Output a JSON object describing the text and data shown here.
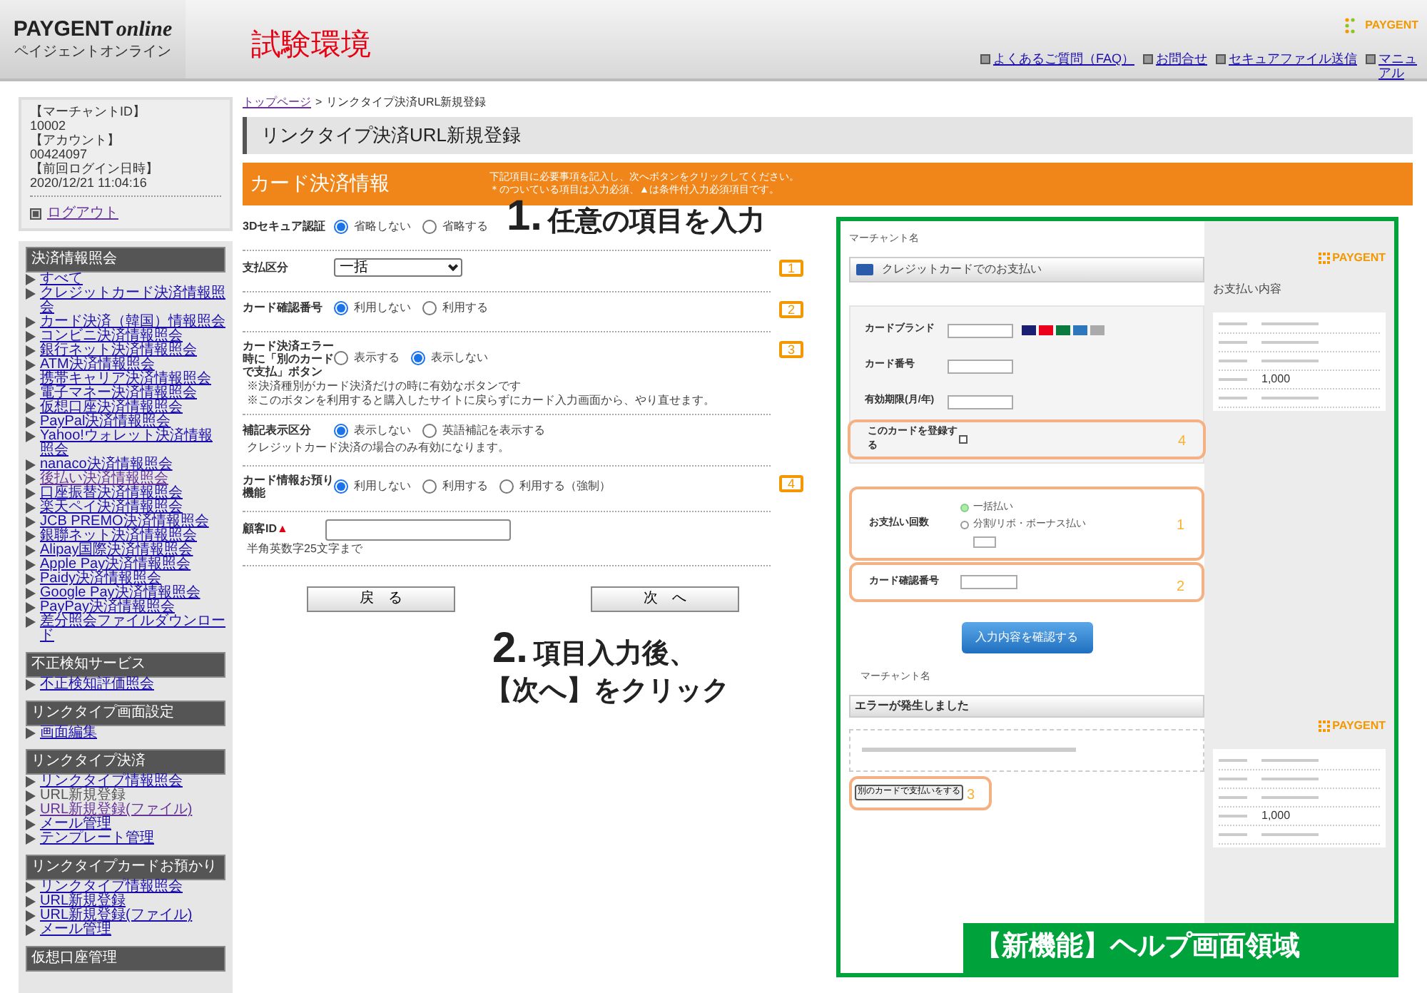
{
  "header": {
    "logo_title": "PAYGENT",
    "logo_suffix": "online",
    "logo_subtitle": "ペイジェントオンライン",
    "environment": "試験環境",
    "brand": "PAYGENT",
    "links": [
      "よくあるご質問（FAQ）",
      "お問合せ",
      "セキュアファイル送信",
      "マニュアル"
    ]
  },
  "account": {
    "lines": [
      "【マーチャントID】",
      "10002",
      "【アカウント】",
      "00424097",
      "【前回ログイン日時】",
      "2020/12/21 11:04:16"
    ],
    "logout": "ログアウト"
  },
  "sidebar": {
    "sections": [
      {
        "title": "決済情報照会",
        "items": [
          {
            "label": "すべて",
            "visited": false,
            "selected": false
          },
          {
            "label": "クレジットカード決済情報照会",
            "visited": false,
            "selected": false
          },
          {
            "label": "カード決済（韓国）情報照会",
            "visited": false,
            "selected": false
          },
          {
            "label": "コンビニ決済情報照会",
            "visited": false,
            "selected": false
          },
          {
            "label": "銀行ネット決済情報照会",
            "visited": false,
            "selected": false
          },
          {
            "label": "ATM決済情報照会",
            "visited": false,
            "selected": false
          },
          {
            "label": "携帯キャリア決済情報照会",
            "visited": false,
            "selected": false
          },
          {
            "label": "電子マネー決済情報照会",
            "visited": false,
            "selected": false
          },
          {
            "label": "仮想口座決済情報照会",
            "visited": false,
            "selected": false
          },
          {
            "label": "PayPal決済情報照会",
            "visited": false,
            "selected": false
          },
          {
            "label": "Yahoo!ウォレット決済情報照会",
            "visited": false,
            "selected": false
          },
          {
            "label": "nanaco決済情報照会",
            "visited": false,
            "selected": false
          },
          {
            "label": "後払い決済情報照会",
            "visited": true,
            "selected": false
          },
          {
            "label": "口座振替決済情報照会",
            "visited": false,
            "selected": false
          },
          {
            "label": "楽天ペイ決済情報照会",
            "visited": false,
            "selected": false
          },
          {
            "label": "JCB PREMO決済情報照会",
            "visited": false,
            "selected": false
          },
          {
            "label": "銀聯ネット決済情報照会",
            "visited": false,
            "selected": false
          },
          {
            "label": "Alipay国際決済情報照会",
            "visited": false,
            "selected": false
          },
          {
            "label": "Apple Pay決済情報照会",
            "visited": false,
            "selected": false
          },
          {
            "label": "Paidy決済情報照会",
            "visited": false,
            "selected": false
          },
          {
            "label": "Google Pay決済情報照会",
            "visited": false,
            "selected": false
          },
          {
            "label": "PayPay決済情報照会",
            "visited": false,
            "selected": false
          },
          {
            "label": "差分照会ファイルダウンロード",
            "visited": false,
            "selected": false
          }
        ]
      },
      {
        "title": "不正検知サービス",
        "items": [
          {
            "label": "不正検知評価照会",
            "visited": false,
            "selected": false
          }
        ]
      },
      {
        "title": "リンクタイプ画面設定",
        "items": [
          {
            "label": "画面編集",
            "visited": false,
            "selected": false
          }
        ]
      },
      {
        "title": "リンクタイプ決済",
        "items": [
          {
            "label": "リンクタイプ情報照会",
            "visited": false,
            "selected": false
          },
          {
            "label": "URL新規登録",
            "visited": false,
            "selected": true
          },
          {
            "label": "URL新規登録(ファイル)",
            "visited": true,
            "selected": false
          },
          {
            "label": "メール管理",
            "visited": false,
            "selected": false
          },
          {
            "label": "テンプレート管理",
            "visited": false,
            "selected": false
          }
        ]
      },
      {
        "title": "リンクタイプカードお預かり",
        "items": [
          {
            "label": "リンクタイプ情報照会",
            "visited": false,
            "selected": false
          },
          {
            "label": "URL新規登録",
            "visited": false,
            "selected": false
          },
          {
            "label": "URL新規登録(ファイル)",
            "visited": false,
            "selected": false
          },
          {
            "label": "メール管理",
            "visited": false,
            "selected": false
          }
        ]
      },
      {
        "title": "仮想口座管理"
      }
    ]
  },
  "breadcrumb": {
    "links": [
      "トップページ",
      "リンクタイプ決済URL新規登録"
    ],
    "separator": ">"
  },
  "page_title": "リンクタイプ決済URL新規登録",
  "section": {
    "title": "カード決済情報",
    "instructions": [
      "下記項目に必要事項を記入し、次へボタンをクリックしてください。",
      "＊のついている項目は入力必須、▲は条件付入力必須項目です。"
    ]
  },
  "form_rows": [
    {
      "kind": "radio",
      "label": "3Dセキュア認証",
      "options": [
        {
          "label": "省略しない",
          "selected": true
        },
        {
          "label": "省略する",
          "selected": false
        }
      ]
    },
    {
      "kind": "select",
      "label": "支払区分",
      "value": "一括",
      "badge": "1"
    },
    {
      "kind": "radio",
      "label": "カード確認番号",
      "badge": "2",
      "options": [
        {
          "label": "利用しない",
          "selected": true
        },
        {
          "label": "利用する",
          "selected": false
        }
      ]
    },
    {
      "kind": "radio",
      "label": "カード決済エラー時に「別のカードで支払」ボタン",
      "badge": "3",
      "options": [
        {
          "label": "表示する",
          "selected": false
        },
        {
          "label": "表示しない",
          "selected": true
        }
      ],
      "notes": [
        "※決済種別がカード決済だけの時に有効なボタンです",
        "※このボタンを利用すると購入したサイトに戻らずにカード入力画面から、やり直せます。"
      ]
    },
    {
      "kind": "radio",
      "label": "補記表示区分",
      "options": [
        {
          "label": "表示しない",
          "selected": true
        },
        {
          "label": "英語補記を表示する",
          "selected": false
        }
      ],
      "notes": [
        "クレジットカード決済の場合のみ有効になります。"
      ]
    },
    {
      "kind": "radio",
      "label": "カード情報お預り機能",
      "badge": "4",
      "options": [
        {
          "label": "利用しない",
          "selected": true
        },
        {
          "label": "利用する",
          "selected": false
        },
        {
          "label": "利用する（強制）",
          "selected": false
        }
      ]
    },
    {
      "kind": "text",
      "label": "顧客ID",
      "mark": "▲",
      "notes": [
        "半角英数字25文字まで"
      ]
    }
  ],
  "buttons": [
    "戻　る",
    "次　へ"
  ],
  "annotations": [
    {
      "number": "1.",
      "lines": [
        "任意の項目を入力"
      ]
    },
    {
      "number": "2.",
      "lines": [
        "項目入力後、",
        "【次へ】をクリック"
      ]
    }
  ],
  "help": {
    "label": "【新機能】ヘルプ画面領域",
    "merchant": "マーチャント名",
    "heading": "クレジットカードでのお支払い",
    "card_fields": [
      "カードブランド",
      "カード番号",
      "有効期限(月/年)"
    ],
    "register": {
      "label": "このカードを登録する",
      "badge": "4",
      "checked": false
    },
    "installments": {
      "label": "お支払い回数",
      "options": [
        {
          "label": "一括払い",
          "selected": true
        },
        {
          "label": "分割/リボ・ボーナス払い",
          "selected": false
        }
      ],
      "badge": "1"
    },
    "security": {
      "label": "カード確認番号",
      "badge": "2"
    },
    "confirm_button": "入力内容を確認する",
    "summary_brand": "PAYGENT",
    "summary_title": "お支払い内容",
    "amount": "1,000",
    "error_brand": "PAYGENT",
    "error_merchant": "マーチャント名",
    "error_heading": "エラーが発生しました",
    "retry_button": "別のカードで支払いをする",
    "retry_badge": "3",
    "error_amount": "1,000"
  }
}
